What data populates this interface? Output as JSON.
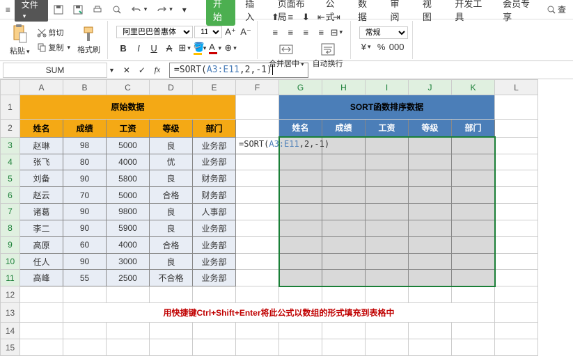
{
  "menubar": {
    "file": "文件",
    "tabs": [
      "开始",
      "插入",
      "页面布局",
      "公式",
      "数据",
      "审阅",
      "视图",
      "开发工具",
      "会员专享"
    ],
    "active_tab": 0,
    "search": "查"
  },
  "ribbon": {
    "paste": "粘贴",
    "cut": "剪切",
    "copy": "复制",
    "format_painter": "格式刷",
    "font_name": "阿里巴巴普惠体",
    "font_size": "11",
    "merge": "合并居中",
    "wrap": "自动换行",
    "number_format": "常规"
  },
  "formula_bar": {
    "name_box": "SUM",
    "formula_prefix": "=SORT(",
    "formula_range": "A3:E11",
    "formula_suffix": ",2,-1)"
  },
  "sheet": {
    "columns": [
      "A",
      "B",
      "C",
      "D",
      "E",
      "F",
      "G",
      "H",
      "I",
      "J",
      "K",
      "L"
    ],
    "title_left": "原始数据",
    "title_right": "SORT函数排序数据",
    "headers": [
      "姓名",
      "成绩",
      "工资",
      "等级",
      "部门"
    ],
    "rows": [
      {
        "name": "赵琳",
        "score": 98,
        "salary": 5000,
        "grade": "良",
        "dept": "业务部"
      },
      {
        "name": "张飞",
        "score": 80,
        "salary": 4000,
        "grade": "优",
        "dept": "业务部"
      },
      {
        "name": "刘备",
        "score": 90,
        "salary": 5800,
        "grade": "良",
        "dept": "财务部"
      },
      {
        "name": "赵云",
        "score": 70,
        "salary": 5000,
        "grade": "合格",
        "dept": "财务部"
      },
      {
        "name": "诸葛",
        "score": 90,
        "salary": 9800,
        "grade": "良",
        "dept": "人事部"
      },
      {
        "name": "李二",
        "score": 90,
        "salary": 5900,
        "grade": "良",
        "dept": "业务部"
      },
      {
        "name": "高原",
        "score": 60,
        "salary": 4000,
        "grade": "合格",
        "dept": "业务部"
      },
      {
        "name": "任人",
        "score": 90,
        "salary": 3000,
        "grade": "良",
        "dept": "业务部"
      },
      {
        "name": "高峰",
        "score": 55,
        "salary": 2500,
        "grade": "不合格",
        "dept": "业务部"
      }
    ],
    "edit_cell_prefix": "=SORT(",
    "edit_cell_range": "A3:E11",
    "edit_cell_suffix": ",2,-1)",
    "hint": "用快捷键Ctrl+Shift+Enter将此公式以数组的形式填充到表格中"
  }
}
